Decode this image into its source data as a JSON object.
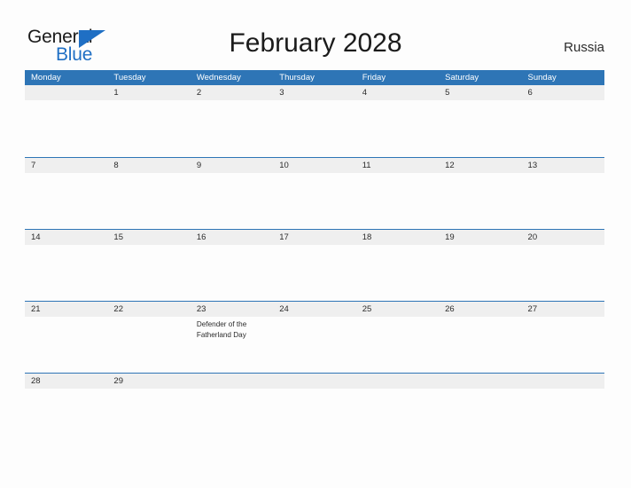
{
  "brand": {
    "name_part1": "General",
    "name_part2": "Blue",
    "flag_color": "#1f6fc4"
  },
  "header": {
    "title": "February 2028",
    "country": "Russia"
  },
  "theme": {
    "header_blue": "#2e75b6",
    "band_gray": "#efefef",
    "page_bg": "#fdfdfd",
    "text_dark": "#2b2b2b"
  },
  "calendar": {
    "weekday_headers": [
      "Monday",
      "Tuesday",
      "Wednesday",
      "Thursday",
      "Friday",
      "Saturday",
      "Sunday"
    ],
    "weeks": [
      [
        {
          "day": "",
          "event": ""
        },
        {
          "day": "1",
          "event": ""
        },
        {
          "day": "2",
          "event": ""
        },
        {
          "day": "3",
          "event": ""
        },
        {
          "day": "4",
          "event": ""
        },
        {
          "day": "5",
          "event": ""
        },
        {
          "day": "6",
          "event": ""
        }
      ],
      [
        {
          "day": "7",
          "event": ""
        },
        {
          "day": "8",
          "event": ""
        },
        {
          "day": "9",
          "event": ""
        },
        {
          "day": "10",
          "event": ""
        },
        {
          "day": "11",
          "event": ""
        },
        {
          "day": "12",
          "event": ""
        },
        {
          "day": "13",
          "event": ""
        }
      ],
      [
        {
          "day": "14",
          "event": ""
        },
        {
          "day": "15",
          "event": ""
        },
        {
          "day": "16",
          "event": ""
        },
        {
          "day": "17",
          "event": ""
        },
        {
          "day": "18",
          "event": ""
        },
        {
          "day": "19",
          "event": ""
        },
        {
          "day": "20",
          "event": ""
        }
      ],
      [
        {
          "day": "21",
          "event": ""
        },
        {
          "day": "22",
          "event": ""
        },
        {
          "day": "23",
          "event": "Defender of the Fatherland Day"
        },
        {
          "day": "24",
          "event": ""
        },
        {
          "day": "25",
          "event": ""
        },
        {
          "day": "26",
          "event": ""
        },
        {
          "day": "27",
          "event": ""
        }
      ],
      [
        {
          "day": "28",
          "event": ""
        },
        {
          "day": "29",
          "event": ""
        },
        {
          "day": "",
          "event": ""
        },
        {
          "day": "",
          "event": ""
        },
        {
          "day": "",
          "event": ""
        },
        {
          "day": "",
          "event": ""
        },
        {
          "day": "",
          "event": ""
        }
      ]
    ]
  }
}
